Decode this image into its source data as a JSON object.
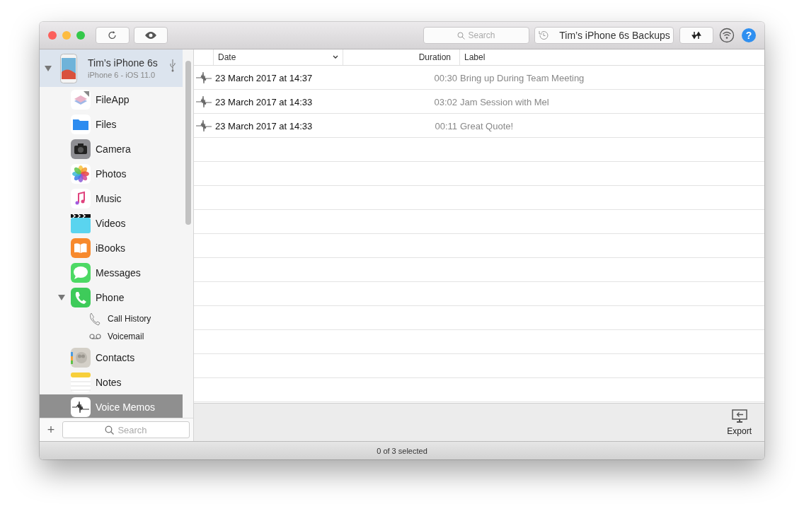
{
  "toolbar": {
    "search": {
      "placeholder": "Search"
    },
    "backups_button": "Tim’s iPhone 6s Backups",
    "help_button": "?"
  },
  "sidebar": {
    "device": {
      "name": "Tim’s iPhone 6s",
      "subtitle": "iPhone 6 - iOS 11.0",
      "expanded": true
    },
    "items": [
      {
        "label": "FileApp",
        "selected": false
      },
      {
        "label": "Files",
        "selected": false
      },
      {
        "label": "Camera",
        "selected": false
      },
      {
        "label": "Photos",
        "selected": false
      },
      {
        "label": "Music",
        "selected": false
      },
      {
        "label": "Videos",
        "selected": false
      },
      {
        "label": "iBooks",
        "selected": false
      },
      {
        "label": "Messages",
        "selected": false
      },
      {
        "label": "Phone",
        "selected": false,
        "expanded": true,
        "children": [
          {
            "label": "Call History",
            "selected": false
          },
          {
            "label": "Voicemail",
            "selected": false
          }
        ]
      },
      {
        "label": "Contacts",
        "selected": false
      },
      {
        "label": "Notes",
        "selected": false
      },
      {
        "label": "Voice Memos",
        "selected": true
      }
    ],
    "add_button": "+",
    "search": {
      "placeholder": "Search"
    }
  },
  "table": {
    "columns": [
      {
        "label": "Date",
        "sorted": true
      },
      {
        "label": "Duration",
        "sorted": false
      },
      {
        "label": "Label",
        "sorted": false
      }
    ],
    "rows": [
      {
        "date": "23 March 2017 at 14:37",
        "duration": "00:30",
        "label": "Bring up During Team Meeting",
        "selected": false
      },
      {
        "date": "23 March 2017 at 14:33",
        "duration": "03:02",
        "label": "Jam Session with Mel",
        "selected": false
      },
      {
        "date": "23 March 2017 at 14:33",
        "duration": "00:11",
        "label": "Great Quote!",
        "selected": false
      }
    ]
  },
  "footer": {
    "export_button": "Export"
  },
  "status_bar": "0 of 3 selected"
}
